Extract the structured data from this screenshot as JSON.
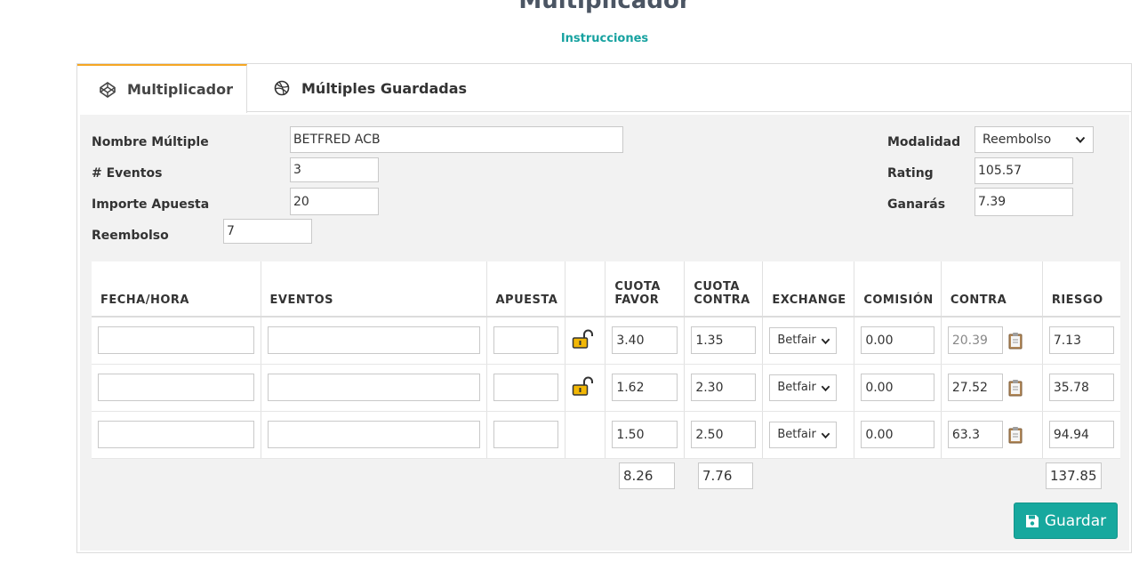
{
  "header": {
    "title": "Multiplicador",
    "instructions_link": "Instrucciones"
  },
  "tabs": [
    {
      "label": "Multiplicador",
      "icon": "codepen-icon",
      "active": true
    },
    {
      "label": "Múltiples Guardadas",
      "icon": "dribbble-icon",
      "active": false
    }
  ],
  "form": {
    "nombre_label": "Nombre Múltiple",
    "nombre_value": "BETFRED ACB",
    "eventos_label": "# Eventos",
    "eventos_value": "3",
    "importe_label": "Importe Apuesta",
    "importe_value": "20",
    "reembolso_label": "Reembolso",
    "reembolso_value": "7",
    "modalidad_label": "Modalidad",
    "modalidad_value": "Reembolso",
    "rating_label": "Rating",
    "rating_value": "105.57",
    "ganaras_label": "Ganarás",
    "ganaras_value": "7.39"
  },
  "table": {
    "headers": {
      "fecha": "FECHA/HORA",
      "eventos": "EVENTOS",
      "apuesta": "APUESTA",
      "lock": "",
      "cuota_favor_1": "CUOTA",
      "cuota_favor_2": "FAVOR",
      "cuota_contra_1": "CUOTA",
      "cuota_contra_2": "CONTRA",
      "exchange": "EXCHANGE",
      "comision": "COMISIÓN",
      "contra": "CONTRA",
      "riesgo": "RIESGO"
    },
    "rows": [
      {
        "fecha": "",
        "evento": "",
        "apuesta": "",
        "locked": true,
        "cuota_favor": "3.40",
        "cuota_contra": "1.35",
        "exchange": "Betfair",
        "comision": "0.00",
        "contra": "20.39",
        "riesgo": "7.13"
      },
      {
        "fecha": "",
        "evento": "",
        "apuesta": "",
        "locked": true,
        "cuota_favor": "1.62",
        "cuota_contra": "2.30",
        "exchange": "Betfair",
        "comision": "0.00",
        "contra": "27.52",
        "riesgo": "35.78"
      },
      {
        "fecha": "",
        "evento": "",
        "apuesta": "",
        "locked": false,
        "cuota_favor": "1.50",
        "cuota_contra": "2.50",
        "exchange": "Betfair",
        "comision": "0.00",
        "contra": "63.3",
        "riesgo": "94.94"
      }
    ],
    "totals": {
      "cuota_favor": "8.26",
      "cuota_contra": "7.76",
      "riesgo": "137.85"
    }
  },
  "actions": {
    "save_label": "Guardar"
  },
  "colors": {
    "accent": "#17a89e",
    "tab_active_border": "#f5a623",
    "link": "#17a2a0",
    "lock": "#f2b705"
  }
}
